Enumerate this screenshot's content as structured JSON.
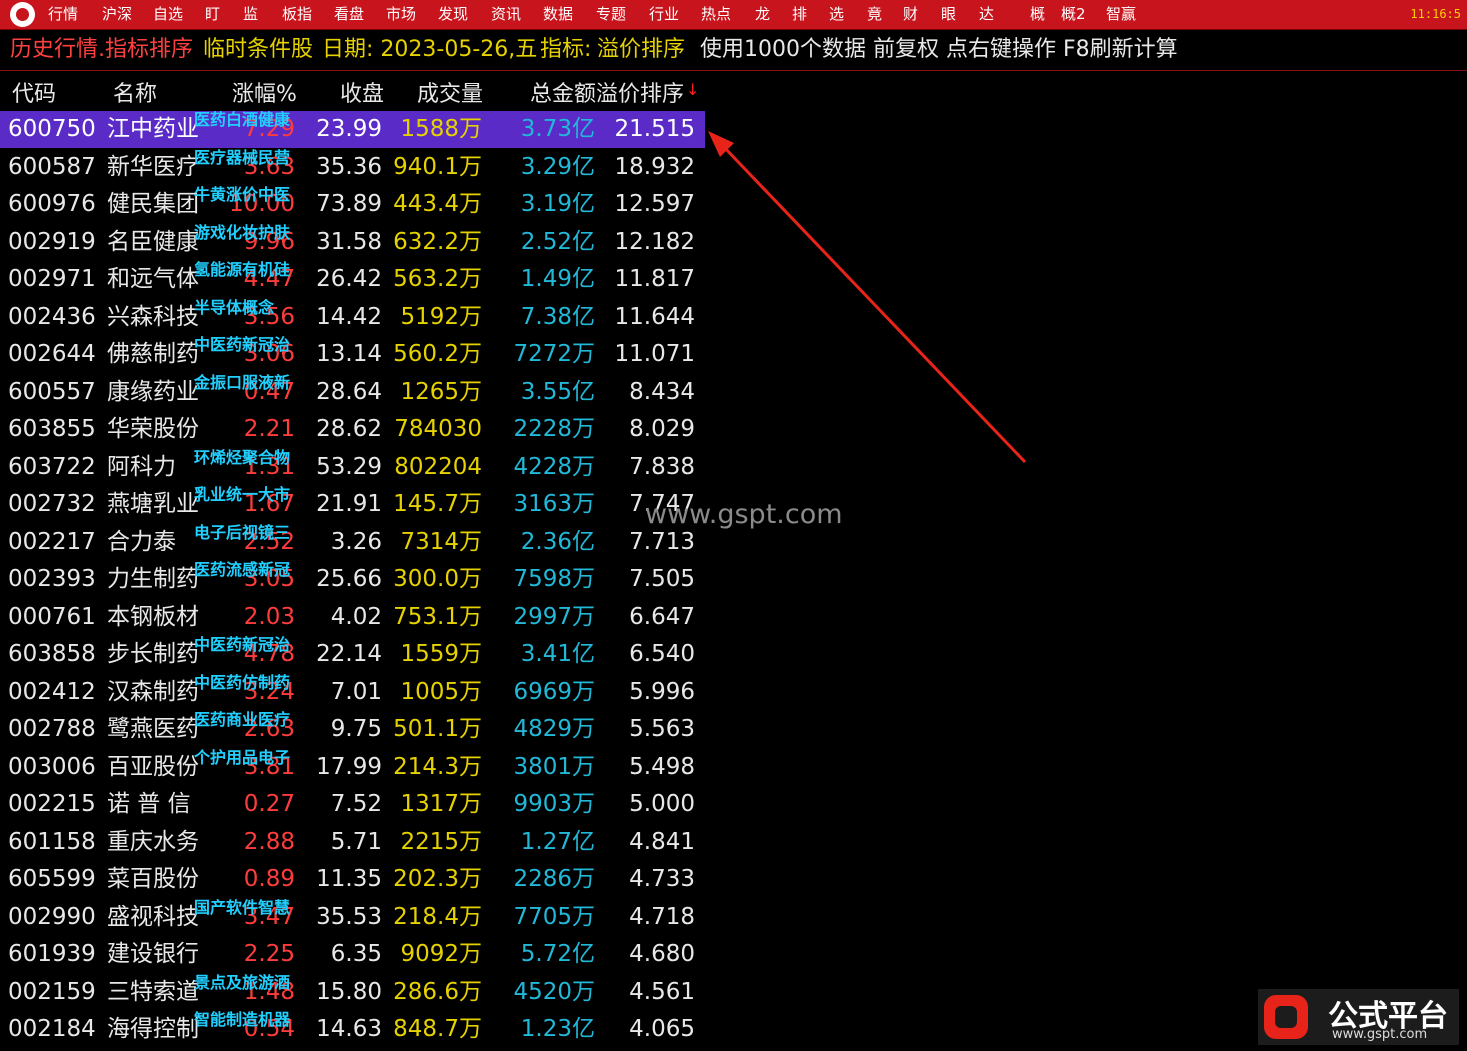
{
  "menubar": {
    "items": [
      "行情",
      "沪深",
      "自选",
      "盯",
      "监",
      "板指",
      "看盘",
      "市场",
      "发现",
      "资讯",
      "数据",
      "专题",
      "行业",
      "热点",
      "龙",
      "排",
      "选",
      "竟",
      "财",
      "眼",
      "达",
      "概",
      "概2",
      "智赢"
    ],
    "clock": "11:16:5"
  },
  "infobar": {
    "crumb": "历史行情.指标排序",
    "pool": "临时条件股",
    "date": "日期: 2023-05-26,五",
    "indicator_label": "指标: ",
    "indicator_value": "溢价排序",
    "note": "使用1000个数据 前复权 点右键操作 F8刷新计算"
  },
  "table": {
    "headers": {
      "code": "代码",
      "name": "名称",
      "pct": "涨幅%",
      "close": "收盘",
      "vol": "成交量",
      "amt_prem": "总金额溢价排序",
      "sort_mark": "↓"
    },
    "rows": [
      {
        "code": "600750",
        "name": "江中药业",
        "tag": "医药白酒健康",
        "pct": "7.29",
        "close": "23.99",
        "vol": "1588万",
        "amt": "3.73亿",
        "prem": "21.515"
      },
      {
        "code": "600587",
        "name": "新华医疗",
        "tag": "医疗器械民营",
        "pct": "3.63",
        "close": "35.36",
        "vol": "940.1万",
        "amt": "3.29亿",
        "prem": "18.932"
      },
      {
        "code": "600976",
        "name": "健民集团",
        "tag": "牛黄涨价中医",
        "pct": "10.00",
        "close": "73.89",
        "vol": "443.4万",
        "amt": "3.19亿",
        "prem": "12.597"
      },
      {
        "code": "002919",
        "name": "名臣健康",
        "tag": "游戏化妆护肤",
        "pct": "9.96",
        "close": "31.58",
        "vol": "632.2万",
        "amt": "2.52亿",
        "prem": "12.182"
      },
      {
        "code": "002971",
        "name": "和远气体",
        "tag": "氢能源有机硅",
        "pct": "4.47",
        "close": "26.42",
        "vol": "563.2万",
        "amt": "1.49亿",
        "prem": "11.817"
      },
      {
        "code": "002436",
        "name": "兴森科技",
        "tag": "半导体概念",
        "pct": "3.56",
        "close": "14.42",
        "vol": "5192万",
        "amt": "7.38亿",
        "prem": "11.644"
      },
      {
        "code": "002644",
        "name": "佛慈制药",
        "tag": "中医药新冠治",
        "pct": "3.06",
        "close": "13.14",
        "vol": "560.2万",
        "amt": "7272万",
        "prem": "11.071"
      },
      {
        "code": "600557",
        "name": "康缘药业",
        "tag": "金振口服液新",
        "pct": "0.47",
        "close": "28.64",
        "vol": "1265万",
        "amt": "3.55亿",
        "prem": "8.434"
      },
      {
        "code": "603855",
        "name": "华荣股份",
        "tag": "",
        "pct": "2.21",
        "close": "28.62",
        "vol": "784030",
        "amt": "2228万",
        "prem": "8.029"
      },
      {
        "code": "603722",
        "name": "阿科力",
        "tag": "环烯烃聚合物",
        "pct": "1.31",
        "close": "53.29",
        "vol": "802204",
        "amt": "4228万",
        "prem": "7.838"
      },
      {
        "code": "002732",
        "name": "燕塘乳业",
        "tag": "乳业统一大市",
        "pct": "1.67",
        "close": "21.91",
        "vol": "145.7万",
        "amt": "3163万",
        "prem": "7.747"
      },
      {
        "code": "002217",
        "name": "合力泰",
        "tag": "电子后视镜三",
        "pct": "2.52",
        "close": "3.26",
        "vol": "7314万",
        "amt": "2.36亿",
        "prem": "7.713"
      },
      {
        "code": "002393",
        "name": "力生制药",
        "tag": "医药流感新冠",
        "pct": "3.05",
        "close": "25.66",
        "vol": "300.0万",
        "amt": "7598万",
        "prem": "7.505"
      },
      {
        "code": "000761",
        "name": "本钢板材",
        "tag": "",
        "pct": "2.03",
        "close": "4.02",
        "vol": "753.1万",
        "amt": "2997万",
        "prem": "6.647"
      },
      {
        "code": "603858",
        "name": "步长制药",
        "tag": "中医药新冠治",
        "pct": "4.78",
        "close": "22.14",
        "vol": "1559万",
        "amt": "3.41亿",
        "prem": "6.540"
      },
      {
        "code": "002412",
        "name": "汉森制药",
        "tag": "中医药仿制药",
        "pct": "3.24",
        "close": "7.01",
        "vol": "1005万",
        "amt": "6969万",
        "prem": "5.996"
      },
      {
        "code": "002788",
        "name": "鹭燕医药",
        "tag": "医药商业医疗",
        "pct": "2.63",
        "close": "9.75",
        "vol": "501.1万",
        "amt": "4829万",
        "prem": "5.563"
      },
      {
        "code": "003006",
        "name": "百亚股份",
        "tag": "个护用品电子",
        "pct": "3.81",
        "close": "17.99",
        "vol": "214.3万",
        "amt": "3801万",
        "prem": "5.498"
      },
      {
        "code": "002215",
        "name": "诺 普 信",
        "tag": "",
        "pct": "0.27",
        "close": "7.52",
        "vol": "1317万",
        "amt": "9903万",
        "prem": "5.000"
      },
      {
        "code": "601158",
        "name": "重庆水务",
        "tag": "",
        "pct": "2.88",
        "close": "5.71",
        "vol": "2215万",
        "amt": "1.27亿",
        "prem": "4.841"
      },
      {
        "code": "605599",
        "name": "菜百股份",
        "tag": "",
        "pct": "0.89",
        "close": "11.35",
        "vol": "202.3万",
        "amt": "2286万",
        "prem": "4.733"
      },
      {
        "code": "002990",
        "name": "盛视科技",
        "tag": "国产软件智慧",
        "pct": "3.47",
        "close": "35.53",
        "vol": "218.4万",
        "amt": "7705万",
        "prem": "4.718"
      },
      {
        "code": "601939",
        "name": "建设银行",
        "tag": "",
        "pct": "2.25",
        "close": "6.35",
        "vol": "9092万",
        "amt": "5.72亿",
        "prem": "4.680"
      },
      {
        "code": "002159",
        "name": "三特索道",
        "tag": "景点及旅游酒",
        "pct": "1.48",
        "close": "15.80",
        "vol": "286.6万",
        "amt": "4520万",
        "prem": "4.561"
      },
      {
        "code": "002184",
        "name": "海得控制",
        "tag": "智能制造机器",
        "pct": "0.54",
        "close": "14.63",
        "vol": "848.7万",
        "amt": "1.23亿",
        "prem": "4.065"
      }
    ]
  },
  "watermark": "www.gspt.com",
  "brand": {
    "name": "公式平台",
    "url": "www.gspt.com"
  },
  "colors": {
    "menubar": "#c8141c",
    "selected_row": "#5a2bc6",
    "up": "#ff3c3c",
    "volume": "#e6d200",
    "amount": "#22b8d8",
    "tag": "#22d0ff",
    "arrow": "#e8241a"
  }
}
